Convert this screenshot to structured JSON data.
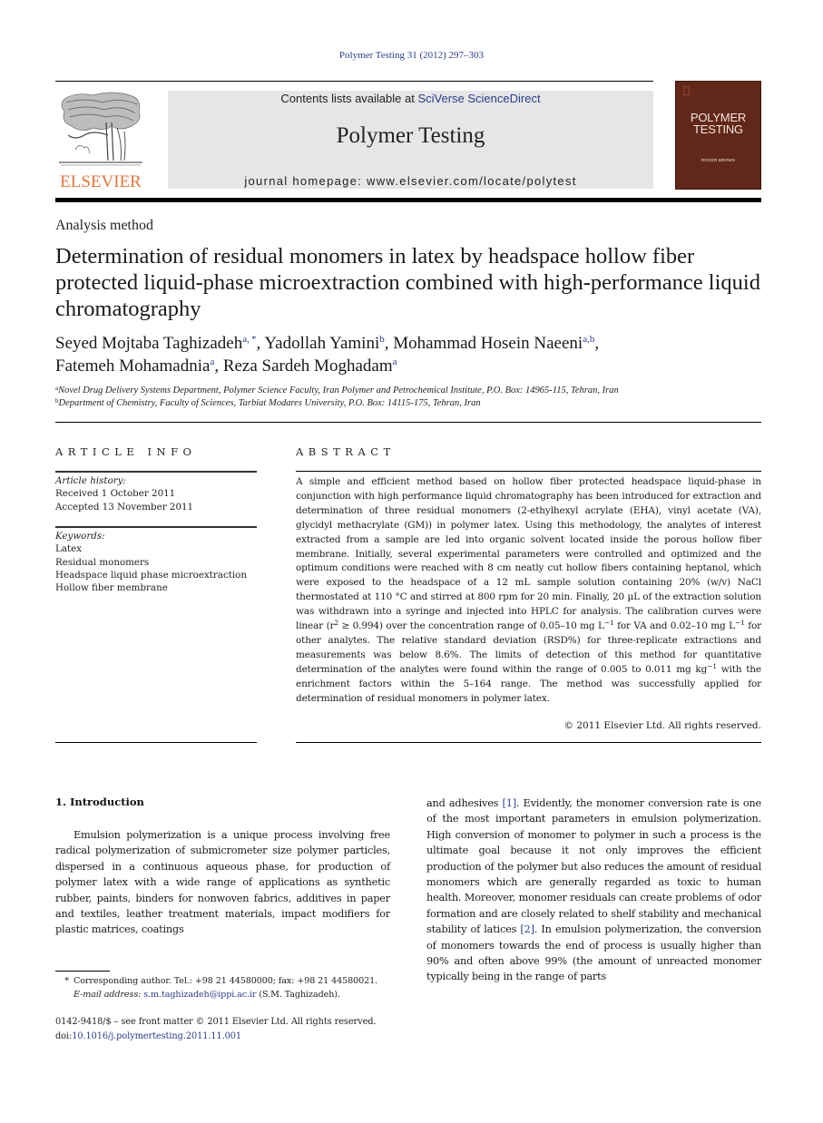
{
  "journal_ref": "Polymer Testing 31 (2012) 297–303",
  "header": {
    "publisher_logo_text": "ELSEVIER",
    "contents_prefix": "Contents lists available at ",
    "contents_link": "SciVerse ScienceDirect",
    "journal_name": "Polymer Testing",
    "homepage_prefix": "journal homepage: ",
    "homepage_url": "www.elsevier.com/locate/polytest",
    "cover": {
      "title_line1": "POLYMER",
      "title_line2": "TESTING",
      "editor": "ROGER BROWN",
      "color": "#612819"
    }
  },
  "article": {
    "type": "Analysis method",
    "title": "Determination of residual monomers in latex by headspace hollow fiber protected liquid-phase microextraction combined with high-performance liquid chromatography",
    "authors": [
      {
        "name": "Seyed Mojtaba Taghizadeh",
        "sup": "a, *"
      },
      {
        "name": "Yadollah Yamini",
        "sup": "b"
      },
      {
        "name": "Mohammad Hosein Naeeni",
        "sup": "a,b"
      },
      {
        "name": "Fatemeh Mohamadnia",
        "sup": "a"
      },
      {
        "name": "Reza Sardeh Moghadam",
        "sup": "a"
      }
    ],
    "affiliations": [
      {
        "key": "a",
        "text": "Novel Drug Delivery Systems Department, Polymer Science Faculty, Iran Polymer and Petrochemical Institute, P.O. Box: 14965-115, Tehran, Iran"
      },
      {
        "key": "b",
        "text": "Department of Chemistry, Faculty of Sciences, Tarbiat Modares University, P.O. Box: 14115-175, Tehran, Iran"
      }
    ]
  },
  "article_info": {
    "heading": "ARTICLE INFO",
    "history_label": "Article history:",
    "received": "Received 1 October 2011",
    "accepted": "Accepted 13 November 2011",
    "keywords_label": "Keywords:",
    "keywords": [
      "Latex",
      "Residual monomers",
      "Headspace liquid phase microextraction",
      "Hollow fiber membrane"
    ]
  },
  "abstract": {
    "heading": "ABSTRACT",
    "part1": "A simple and efficient method based on hollow fiber protected headspace liquid-phase in conjunction with high performance liquid chromatography has been introduced for extraction and determination of three residual monomers (2-ethylhexyl acrylate (EHA), vinyl acetate (VA), glycidyl methacrylate (GM)) in polymer latex. Using this methodology, the analytes of interest extracted from a sample are led into organic solvent located inside the porous hollow fiber membrane. Initially, several experimental parameters were controlled and optimized and the optimum conditions were reached with 8 cm neatly cut hollow fibers containing heptanol, which were exposed to the headspace of a 12 mL sample solution containing 20% (w/v) NaCl thermostated at 110 °C and stirred at 800 rpm for 20 min. Finally, 20 µL of the extraction solution was withdrawn into a syringe and injected into HPLC for analysis. The calibration curves were linear (r",
    "sup_r2": "2",
    "part2": " ≥ 0.994) over the concentration range of 0.05–10 mg L",
    "sup_neg1_a": "−1",
    "part3": " for VA and 0.02–10 mg L",
    "sup_neg1_b": "−1",
    "part4": " for other analytes. The relative standard deviation (RSD%) for three-replicate extractions and measurements was below 8.6%. The limits of detection of this method for quantitative determination of the analytes were found within the range of 0.005 to 0.011 mg kg",
    "sup_neg1_c": "−1",
    "part5": " with the enrichment factors within the 5–164 range. The method was successfully applied for determination of residual monomers in polymer latex.",
    "copyright": "© 2011 Elsevier Ltd. All rights reserved."
  },
  "introduction": {
    "heading": "1.  Introduction",
    "left_text": "Emulsion polymerization is a unique process involving free radical polymerization of submicrometer size polymer particles, dispersed in a continuous aqueous phase, for production of polymer latex with a wide range of applications as synthetic rubber, paints, binders for nonwoven fabrics, additives in paper and textiles, leather treatment materials, impact modifiers for plastic matrices, coatings",
    "right_part1": "and adhesives ",
    "ref1": "[1]",
    "right_part2": ". Evidently, the monomer conversion rate is one of the most important parameters in emulsion polymerization. High conversion of monomer to polymer in such a process is the ultimate goal because it not only improves the efficient production of the polymer but also reduces the amount of residual monomers which are generally regarded as toxic to human health. Moreover, monomer residuals can create problems of odor formation and are closely related to shelf stability and mechanical stability of latices ",
    "ref2": "[2]",
    "right_part3": ". In emulsion polymerization, the conversion of monomers towards the end of process is usually higher than 90% and often above 99% (the amount of unreacted monomer typically being in the range of parts"
  },
  "footnote": {
    "star": "*",
    "corresponding": "Corresponding author. Tel.: +98 21 44580000; fax: +98 21 44580021.",
    "email_label": "E-mail address:",
    "email": "s.m.taghizadeh@ippi.ac.ir",
    "email_suffix": " (S.M. Taghizadeh)."
  },
  "front_matter": {
    "issn_line": "0142-9418/$ – see front matter © 2011 Elsevier Ltd. All rights reserved.",
    "doi_prefix": "doi:",
    "doi": "10.1016/j.polymertesting.2011.11.001"
  },
  "colors": {
    "link": "#2a3d8f",
    "elsevier_orange": "#e8743b",
    "banner_gray": "#e6e6e6"
  }
}
